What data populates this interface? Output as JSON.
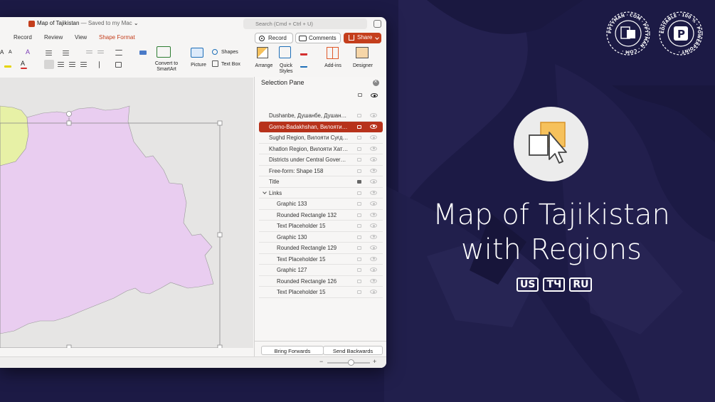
{
  "window": {
    "doc_title": "Map of Tajikistan",
    "doc_subtitle": " — Saved to my Mac",
    "search_placeholder": "Search (Cmd + Ctrl + U)"
  },
  "tabs": [
    {
      "label": "Record",
      "active": false
    },
    {
      "label": "Review",
      "active": false
    },
    {
      "label": "View",
      "active": false
    },
    {
      "label": "Shape Format",
      "active": true
    }
  ],
  "top_buttons": {
    "record": "Record",
    "comments": "Comments",
    "share": "Share"
  },
  "ribbon": {
    "convert_smartart": "Convert to SmartArt",
    "picture": "Picture",
    "shapes": "Shapes",
    "text_box": "Text Box",
    "arrange": "Arrange",
    "quick_styles": "Quick Styles",
    "addins": "Add-ins",
    "designer": "Designer"
  },
  "selection_pane": {
    "title": "Selection Pane",
    "items": [
      {
        "label": "Dushanbe, Душанбе, Душан…",
        "indent": 0,
        "selected": false,
        "locked": false
      },
      {
        "label": "Gorno-Badakhshan, Вилояти…",
        "indent": 0,
        "selected": true,
        "locked": false
      },
      {
        "label": "Sughd Region, Вилояти Суғд…",
        "indent": 0,
        "selected": false,
        "locked": false
      },
      {
        "label": "Khatlon Region, Вилояти Хат…",
        "indent": 0,
        "selected": false,
        "locked": false
      },
      {
        "label": "Districts under Central Gover…",
        "indent": 0,
        "selected": false,
        "locked": false
      },
      {
        "label": "Free-form: Shape 158",
        "indent": 0,
        "selected": false,
        "locked": false
      },
      {
        "label": "Title",
        "indent": 0,
        "selected": false,
        "locked": true
      },
      {
        "label": "Links",
        "indent": 0,
        "selected": false,
        "locked": false,
        "group": true
      },
      {
        "label": "Graphic 133",
        "indent": 1,
        "selected": false,
        "locked": false
      },
      {
        "label": "Rounded Rectangle 132",
        "indent": 1,
        "selected": false,
        "locked": false
      },
      {
        "label": "Text Placeholder 15",
        "indent": 1,
        "selected": false,
        "locked": false
      },
      {
        "label": "Graphic 130",
        "indent": 1,
        "selected": false,
        "locked": false
      },
      {
        "label": "Rounded Rectangle 129",
        "indent": 1,
        "selected": false,
        "locked": false
      },
      {
        "label": "Text Placeholder 15",
        "indent": 1,
        "selected": false,
        "locked": false
      },
      {
        "label": "Graphic 127",
        "indent": 1,
        "selected": false,
        "locked": false
      },
      {
        "label": "Rounded Rectangle 126",
        "indent": 1,
        "selected": false,
        "locked": false
      },
      {
        "label": "Text Placeholder 15",
        "indent": 1,
        "selected": false,
        "locked": false
      }
    ],
    "bring_forwards": "Bring Forwards",
    "send_backwards": "Send Backwards"
  },
  "hero": {
    "title_line1": "Map of Tajikistan",
    "title_line2": "with Regions",
    "languages": [
      "US",
      "ТЧ",
      "RU"
    ]
  },
  "badges": {
    "left_text": "PPTYMAN · COM · PPTYMAN · COM ·",
    "right_text": "EDITABLE · 100 % · POWERPOINT ·"
  },
  "colors": {
    "background": "#1c1a45",
    "accent": "#c43e1c",
    "selected_row": "#b7321b",
    "region_pink": "#e9cdf0",
    "region_green": "#e7f1a6"
  }
}
